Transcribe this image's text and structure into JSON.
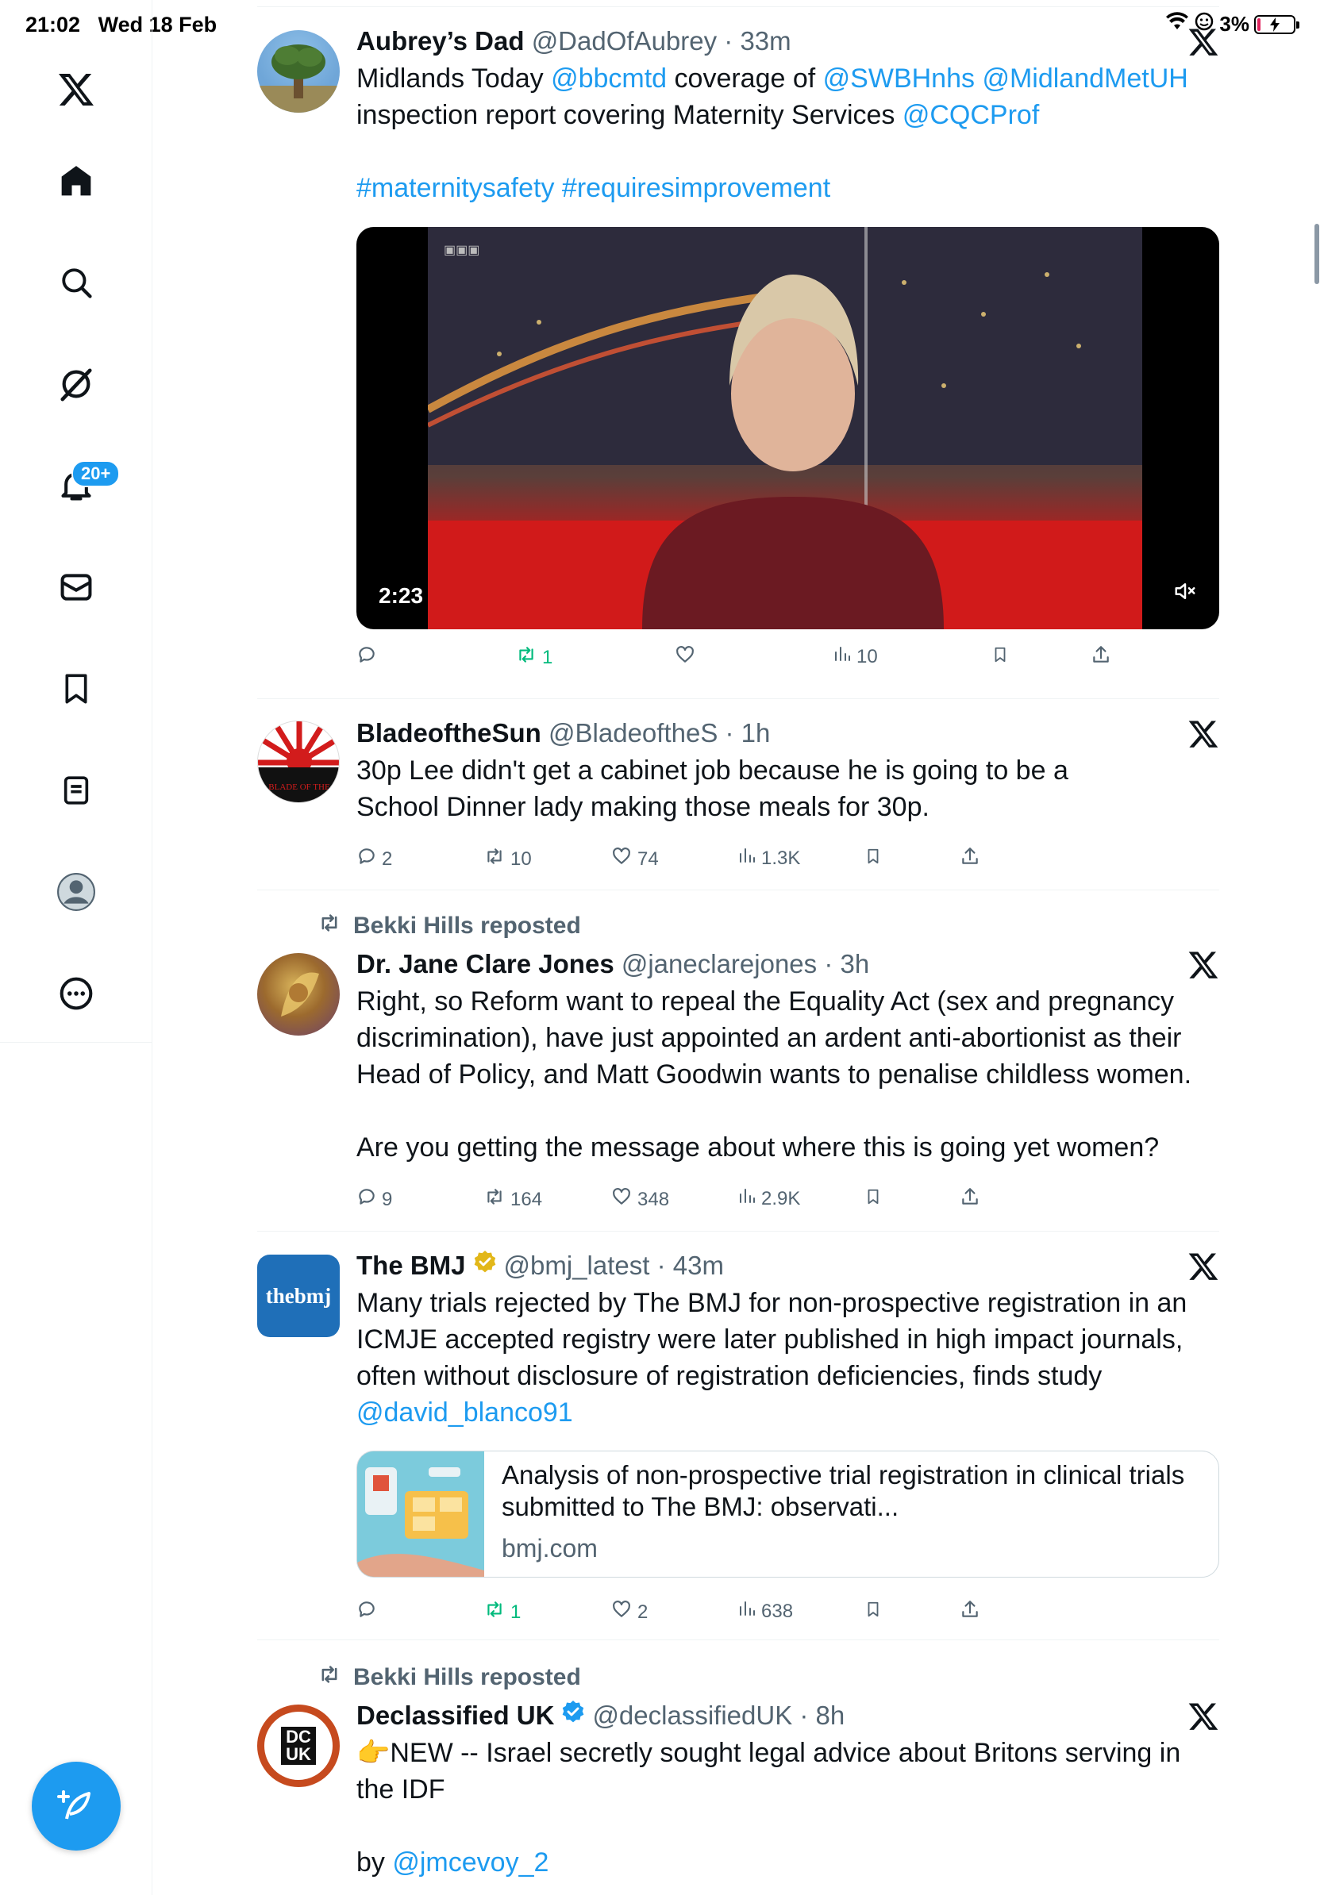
{
  "status": {
    "time": "21:02",
    "date": "Wed 18 Feb",
    "battery": "3%"
  },
  "sidebar": {
    "items": [
      {
        "name": "home"
      },
      {
        "name": "explore"
      },
      {
        "name": "grok"
      },
      {
        "name": "notifications",
        "badge": "20+"
      },
      {
        "name": "messages"
      },
      {
        "name": "bookmarks"
      },
      {
        "name": "lists"
      },
      {
        "name": "profile"
      },
      {
        "name": "more"
      }
    ]
  },
  "colors": {
    "accent": "#1d9bf0",
    "retweet": "#00ba7c",
    "muted": "#536471"
  },
  "tweets": [
    {
      "name": "Aubrey’s Dad",
      "handle": "@DadOfAubrey",
      "time": "33m",
      "segments": [
        {
          "t": "Midlands Today ",
          "l": false
        },
        {
          "t": "@bbcmtd",
          "l": true
        },
        {
          "t": " coverage of ",
          "l": false
        },
        {
          "t": "@SWBHnhs",
          "l": true
        },
        {
          "t": " ",
          "l": false
        },
        {
          "t": "@MidlandMetUH",
          "l": true
        },
        {
          "t": " inspection report covering Maternity Services ",
          "l": false
        },
        {
          "t": "@CQCProf",
          "l": true
        }
      ],
      "hashtags": [
        {
          "t": "#maternitysafety",
          "l": true
        },
        {
          "t": " ",
          "l": false
        },
        {
          "t": "#requiresimprovement",
          "l": true
        }
      ],
      "video_duration": "2:23",
      "stats": {
        "reply": "",
        "retweet": "1",
        "like": "",
        "views": "10"
      }
    },
    {
      "name": "BladeoftheSun",
      "handle": "@BladeoftheS",
      "time": "1h",
      "text": "30p Lee didn't get a cabinet job because he is going to be a School Dinner lady making those meals for 30p.",
      "stats": {
        "reply": "2",
        "retweet": "10",
        "like": "74",
        "views": "1.3K"
      }
    },
    {
      "reposted_by": "Bekki Hills reposted",
      "name": "Dr. Jane Clare Jones",
      "handle": "@janeclarejones",
      "time": "3h",
      "text": "Right, so Reform want to repeal the Equality Act (sex and pregnancy discrimination), have just appointed an ardent anti-abortionist as their Head of Policy, and Matt Goodwin wants to penalise childless women.",
      "text2": "Are you getting the message about where this is going yet women?",
      "stats": {
        "reply": "9",
        "retweet": "164",
        "like": "348",
        "views": "2.9K"
      }
    },
    {
      "name": "The BMJ",
      "handle": "@bmj_latest",
      "time": "43m",
      "verified": "gold",
      "avatar_text": "thebmj",
      "text": "Many trials rejected by The BMJ for non-prospective registration in an ICMJE accepted registry were later published in high impact journals, often without disclosure of registration deficiencies, finds study",
      "mention": "@david_blanco91",
      "card": {
        "title": "Analysis of non-prospective trial registration in clinical trials submitted to The BMJ: observati...",
        "domain": "bmj.com"
      },
      "stats": {
        "reply": "",
        "retweet": "1",
        "like": "2",
        "views": "638"
      }
    },
    {
      "reposted_by": "Bekki Hills reposted",
      "name": "Declassified UK",
      "handle": "@declassifiedUK",
      "time": "8h",
      "verified": "blue",
      "avatar_text": "DC UK",
      "text_prefix": "👉",
      "text": "NEW -- Israel secretly sought legal advice about Britons serving in the IDF",
      "by_label": "by ",
      "by_mention": "@jmcevoy_2"
    }
  ]
}
